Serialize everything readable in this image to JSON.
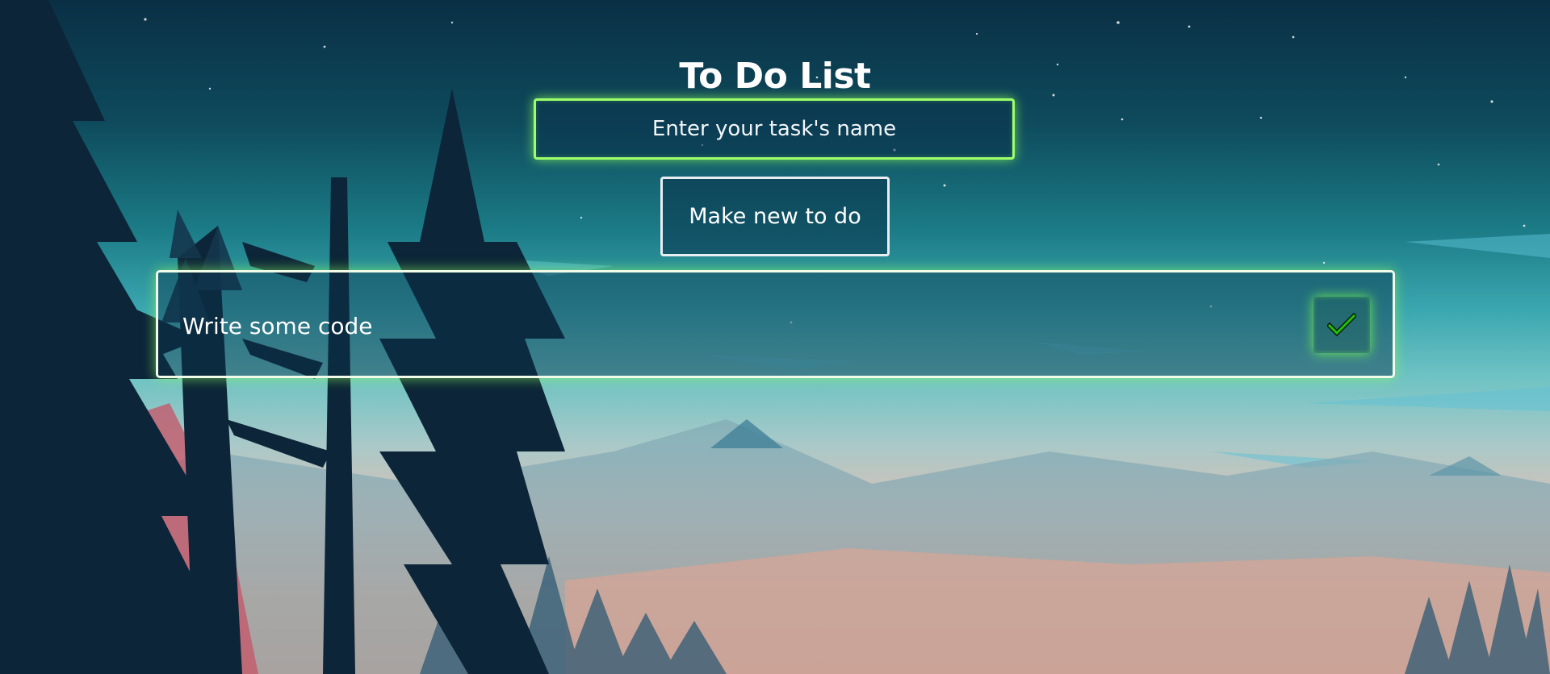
{
  "page": {
    "title": "To Do List"
  },
  "new_task": {
    "placeholder": "Enter your task's name",
    "value": "",
    "submit_label": "Make new to do"
  },
  "todos": [
    {
      "text": "Write some code",
      "action_icon": "checkmark-icon"
    }
  ],
  "colors": {
    "glow_accent": "#9dff6b",
    "check_green": "#22c000",
    "text": "#ffffff"
  }
}
